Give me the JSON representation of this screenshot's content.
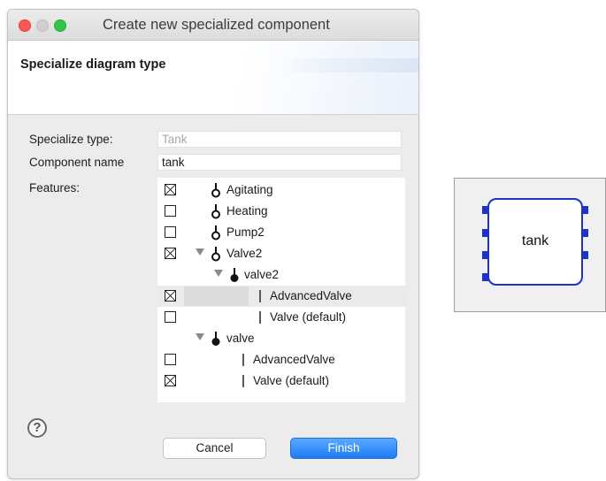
{
  "window": {
    "title": "Create new specialized component"
  },
  "banner": {
    "title": "Specialize diagram type"
  },
  "form": {
    "specialize_type_label": "Specialize type:",
    "specialize_type_value": "Tank",
    "component_name_label": "Component name",
    "component_name_value": "tank",
    "features_label": "Features:"
  },
  "features": [
    {
      "label": "Agitating",
      "checkbox": "checked",
      "icon": "optional-feature-icon"
    },
    {
      "label": "Heating",
      "checkbox": "unchecked",
      "icon": "optional-feature-icon"
    },
    {
      "label": "Pump2",
      "checkbox": "unchecked",
      "icon": "optional-feature-icon"
    },
    {
      "label": "Valve2",
      "checkbox": "checked",
      "icon": "optional-feature-icon",
      "expanded": true
    },
    {
      "label": "valve2",
      "checkbox": "none",
      "icon": "mandatory-feature-icon",
      "expanded": true
    },
    {
      "label": "AdvancedValve",
      "checkbox": "checked",
      "icon": "alternative-bar-icon",
      "selected": true
    },
    {
      "label": "Valve (default)",
      "checkbox": "unchecked",
      "icon": "alternative-bar-icon"
    },
    {
      "label": "valve",
      "checkbox": "none",
      "icon": "mandatory-feature-icon",
      "expanded": true
    },
    {
      "label": "AdvancedValve",
      "checkbox": "unchecked",
      "icon": "alternative-bar-icon"
    },
    {
      "label": "Valve (default)",
      "checkbox": "checked",
      "icon": "alternative-bar-icon"
    }
  ],
  "buttons": {
    "help": "?",
    "cancel": "Cancel",
    "finish": "Finish"
  },
  "preview": {
    "component_label": "tank",
    "accent_color": "#1c32c8"
  },
  "colors": {
    "finish_button": "#1f7cf4",
    "close_light": "#fc5753",
    "max_light": "#33c748"
  }
}
